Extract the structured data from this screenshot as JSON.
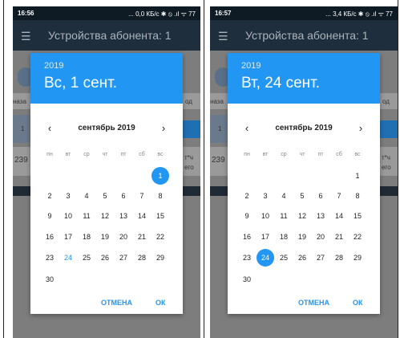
{
  "screens": [
    {
      "status": {
        "time": "16:56",
        "info": "... 0,0 КБ/с ✱ ⦸ .ıl ᯤ 77"
      },
      "app": {
        "title": "Устройства абонента: 1"
      },
      "background": {
        "left_text": "наза",
        "right_text": "од",
        "code": "239",
        "small": "1",
        "unit": "т*ч",
        "total": "его"
      },
      "dialog": {
        "year": "2019",
        "date": "Вс, 1 сент.",
        "month": "сентябрь 2019",
        "prev_icon": "‹",
        "next_icon": "›",
        "weekdays": [
          "пн",
          "вт",
          "ср",
          "чт",
          "пт",
          "сб",
          "вс"
        ],
        "first_weekday_index": 6,
        "days_in_month": 30,
        "selected_day": 1,
        "highlighted_day": 24,
        "cancel_label": "ОТМЕНА",
        "ok_label": "ОК"
      }
    },
    {
      "status": {
        "time": "16:57",
        "info": "... 3,4 КБ/с ✱ ⦸ .ıl ᯤ 77"
      },
      "app": {
        "title": "Устройства абонента: 1"
      },
      "background": {
        "left_text": "наза",
        "right_text": "од",
        "code": "239",
        "small": "1",
        "unit": "т*ч",
        "total": "его"
      },
      "dialog": {
        "year": "2019",
        "date": "Вт, 24 сент.",
        "month": "сентябрь 2019",
        "prev_icon": "‹",
        "next_icon": "›",
        "weekdays": [
          "пн",
          "вт",
          "ср",
          "чт",
          "пт",
          "сб",
          "вс"
        ],
        "first_weekday_index": 6,
        "days_in_month": 30,
        "selected_day": 24,
        "highlighted_day": null,
        "cancel_label": "ОТМЕНА",
        "ok_label": "ОК"
      }
    }
  ],
  "colors": {
    "accent": "#2196f3",
    "appbar": "#1e2e3d",
    "statusbar": "#0e1a24",
    "scrim": "#7d7d7d"
  }
}
